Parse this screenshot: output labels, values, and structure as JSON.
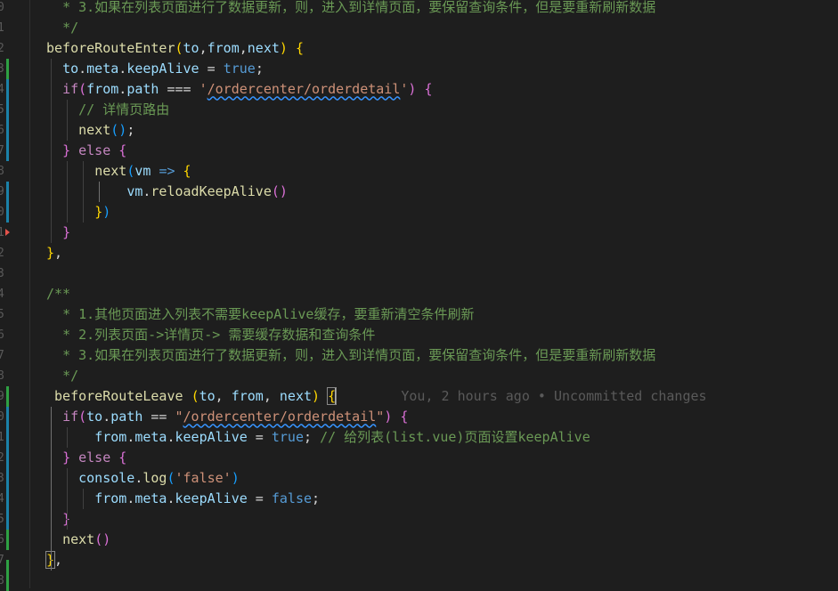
{
  "editor": {
    "lines": [
      {
        "indent": "  ",
        "segs": [
          [
            "cm",
            "* 3.如果在列表页面进行了数据更新，则，进入到详情页面，要保留查询条件，但是要重新刷新数据"
          ]
        ]
      },
      {
        "indent": "  ",
        "segs": [
          [
            "cm",
            "*/"
          ]
        ]
      },
      {
        "indent": "",
        "segs": [
          [
            "fn",
            "beforeRouteEnter"
          ],
          [
            "b1",
            "("
          ],
          [
            "var",
            "to"
          ],
          [
            "op",
            ","
          ],
          [
            "var",
            "from"
          ],
          [
            "op",
            ","
          ],
          [
            "var",
            "next"
          ],
          [
            "b1",
            ")"
          ],
          [
            "op",
            " "
          ],
          [
            "b1",
            "{"
          ]
        ]
      },
      {
        "indent": "  ",
        "segs": [
          [
            "var",
            "to"
          ],
          [
            "op",
            "."
          ],
          [
            "var",
            "meta"
          ],
          [
            "op",
            "."
          ],
          [
            "var",
            "keepAlive"
          ],
          [
            "op",
            " = "
          ],
          [
            "kw",
            "true"
          ],
          [
            "op",
            ";"
          ]
        ]
      },
      {
        "indent": "  ",
        "segs": [
          [
            "ctl",
            "if"
          ],
          [
            "b2",
            "("
          ],
          [
            "var",
            "from"
          ],
          [
            "op",
            "."
          ],
          [
            "var",
            "path"
          ],
          [
            "op",
            " === "
          ],
          [
            "str",
            "'"
          ],
          [
            "str sq",
            "/ordercenter/orderdetail"
          ],
          [
            "str",
            "'"
          ],
          [
            "b2",
            ")"
          ],
          [
            "op",
            " "
          ],
          [
            "b2",
            "{"
          ]
        ]
      },
      {
        "indent": "    ",
        "segs": [
          [
            "cm",
            "// 详情页路由"
          ]
        ]
      },
      {
        "indent": "    ",
        "segs": [
          [
            "fn",
            "next"
          ],
          [
            "b3",
            "("
          ],
          [
            "b3",
            ")"
          ],
          [
            "op",
            ";"
          ]
        ]
      },
      {
        "indent": "  ",
        "segs": [
          [
            "b2",
            "}"
          ],
          [
            "op",
            " "
          ],
          [
            "ctl",
            "else"
          ],
          [
            "op",
            " "
          ],
          [
            "b2",
            "{"
          ]
        ]
      },
      {
        "indent": "      ",
        "segs": [
          [
            "fn",
            "next"
          ],
          [
            "b3",
            "("
          ],
          [
            "var",
            "vm"
          ],
          [
            "op",
            " "
          ],
          [
            "kw",
            "=>"
          ],
          [
            "op",
            " "
          ],
          [
            "b1",
            "{"
          ]
        ]
      },
      {
        "indent": "          ",
        "segs": [
          [
            "var",
            "vm"
          ],
          [
            "op",
            "."
          ],
          [
            "fn",
            "reloadKeepAlive"
          ],
          [
            "b2",
            "("
          ],
          [
            "b2",
            ")"
          ]
        ]
      },
      {
        "indent": "      ",
        "segs": [
          [
            "b1",
            "}"
          ],
          [
            "b3",
            ")"
          ]
        ]
      },
      {
        "indent": "  ",
        "segs": [
          [
            "b2",
            "}"
          ]
        ]
      },
      {
        "indent": "",
        "segs": [
          [
            "b1",
            "}"
          ],
          [
            "op",
            ","
          ]
        ]
      },
      {
        "indent": "",
        "segs": []
      },
      {
        "indent": "",
        "segs": [
          [
            "cm",
            "/**"
          ]
        ]
      },
      {
        "indent": "  ",
        "segs": [
          [
            "cm",
            "* 1.其他页面进入列表不需要keepAlive缓存，要重新清空条件刷新"
          ]
        ]
      },
      {
        "indent": "  ",
        "segs": [
          [
            "cm",
            "* 2.列表页面->详情页-> 需要缓存数据和查询条件"
          ]
        ]
      },
      {
        "indent": "  ",
        "segs": [
          [
            "cm",
            "* 3.如果在列表页面进行了数据更新，则，进入到详情页面，要保留查询条件，但是要重新刷新数据"
          ]
        ]
      },
      {
        "indent": "  ",
        "segs": [
          [
            "cm",
            "*/"
          ]
        ]
      },
      {
        "indent": " ",
        "segs": [
          [
            "fn",
            "beforeRouteLeave"
          ],
          [
            "op",
            " "
          ],
          [
            "b1",
            "("
          ],
          [
            "var",
            "to"
          ],
          [
            "op",
            ", "
          ],
          [
            "var",
            "from"
          ],
          [
            "op",
            ", "
          ],
          [
            "var",
            "next"
          ],
          [
            "b1",
            ")"
          ],
          [
            "op",
            " "
          ],
          [
            "b1 bracket-hl",
            "{"
          ],
          [
            "cursor",
            ""
          ],
          [
            "op",
            "        "
          ],
          [
            "blame",
            "You, 2 hours ago • Uncommitted changes"
          ]
        ]
      },
      {
        "indent": "  ",
        "segs": [
          [
            "ctl",
            "if"
          ],
          [
            "b2",
            "("
          ],
          [
            "var",
            "to"
          ],
          [
            "op",
            "."
          ],
          [
            "var",
            "path"
          ],
          [
            "op",
            " == "
          ],
          [
            "str",
            "\""
          ],
          [
            "str sq",
            "/ordercenter/orderdetail"
          ],
          [
            "str",
            "\""
          ],
          [
            "b2",
            ")"
          ],
          [
            "op",
            " "
          ],
          [
            "b2",
            "{"
          ]
        ]
      },
      {
        "indent": "      ",
        "segs": [
          [
            "var",
            "from"
          ],
          [
            "op",
            "."
          ],
          [
            "var",
            "meta"
          ],
          [
            "op",
            "."
          ],
          [
            "var",
            "keepAlive"
          ],
          [
            "op",
            " = "
          ],
          [
            "kw",
            "true"
          ],
          [
            "op",
            "; "
          ],
          [
            "cm",
            "// 给列表(list.vue)页面设置keepAlive"
          ]
        ]
      },
      {
        "indent": "  ",
        "segs": [
          [
            "b2",
            "}"
          ],
          [
            "op",
            " "
          ],
          [
            "ctl",
            "else"
          ],
          [
            "op",
            " "
          ],
          [
            "b2",
            "{"
          ]
        ]
      },
      {
        "indent": "    ",
        "segs": [
          [
            "var",
            "console"
          ],
          [
            "op",
            "."
          ],
          [
            "fn",
            "log"
          ],
          [
            "b3",
            "("
          ],
          [
            "str",
            "'false'"
          ],
          [
            "b3",
            ")"
          ]
        ]
      },
      {
        "indent": "      ",
        "segs": [
          [
            "var",
            "from"
          ],
          [
            "op",
            "."
          ],
          [
            "var",
            "meta"
          ],
          [
            "op",
            "."
          ],
          [
            "var",
            "keepAlive"
          ],
          [
            "op",
            " = "
          ],
          [
            "kw",
            "false"
          ],
          [
            "op",
            ";"
          ]
        ]
      },
      {
        "indent": "  ",
        "segs": [
          [
            "b2",
            "}"
          ]
        ]
      },
      {
        "indent": "  ",
        "segs": [
          [
            "fn",
            "next"
          ],
          [
            "b2",
            "("
          ],
          [
            "b2",
            ")"
          ]
        ]
      },
      {
        "indent": "",
        "segs": [
          [
            "b1 bracket-hl",
            "}"
          ],
          [
            "op",
            ","
          ]
        ]
      }
    ],
    "gutter_numbers": [
      "0",
      "1",
      "2",
      "3",
      "4",
      "5",
      "6",
      "7",
      "8",
      "9",
      "0",
      "1",
      "2",
      "3",
      "4",
      "5",
      "6",
      "7",
      "8",
      "9",
      "0",
      "1",
      "2",
      "3",
      "4",
      "5",
      "6",
      "7",
      "8"
    ],
    "colors": {
      "background": "#1e1e1e",
      "comment": "#6a9955",
      "keyword": "#569cd6",
      "control": "#c586c0",
      "function": "#dcdcaa",
      "variable": "#9cdcfe",
      "string": "#ce9178",
      "git_added": "#2ea043",
      "git_modified": "#1b81a8",
      "git_deleted": "#e5534b"
    }
  }
}
